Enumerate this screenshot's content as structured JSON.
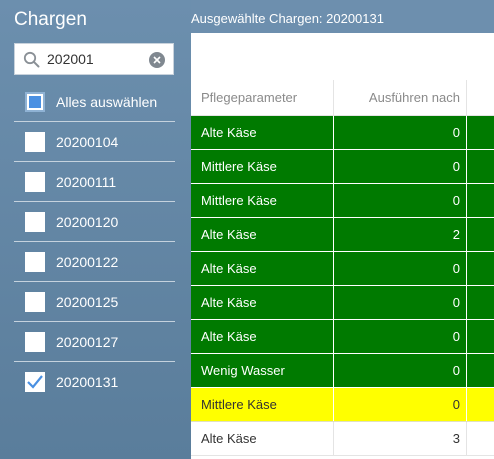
{
  "sidebar": {
    "title": "Chargen",
    "search": {
      "value": "202001",
      "placeholder": ""
    },
    "select_all_label": "Alles auswählen",
    "items": [
      {
        "label": "20200104",
        "checked": false
      },
      {
        "label": "20200111",
        "checked": false
      },
      {
        "label": "20200120",
        "checked": false
      },
      {
        "label": "20200122",
        "checked": false
      },
      {
        "label": "20200125",
        "checked": false
      },
      {
        "label": "20200127",
        "checked": false
      },
      {
        "label": "20200131",
        "checked": true
      }
    ]
  },
  "main": {
    "title": "Ausgewählte Chargen: 20200131",
    "columns": [
      "Pflegeparameter",
      "Ausführen nach",
      ""
    ],
    "rows": [
      {
        "parameter": "Alte Käse",
        "after": "0",
        "status": "green"
      },
      {
        "parameter": "Mittlere Käse",
        "after": "0",
        "status": "green"
      },
      {
        "parameter": "Mittlere Käse",
        "after": "0",
        "status": "green"
      },
      {
        "parameter": "Alte Käse",
        "after": "2",
        "status": "green"
      },
      {
        "parameter": "Alte Käse",
        "after": "0",
        "status": "green"
      },
      {
        "parameter": "Alte Käse",
        "after": "0",
        "status": "green"
      },
      {
        "parameter": "Alte Käse",
        "after": "0",
        "status": "green"
      },
      {
        "parameter": "Wenig Wasser",
        "after": "0",
        "status": "green"
      },
      {
        "parameter": "Mittlere Käse",
        "after": "0",
        "status": "yellow"
      },
      {
        "parameter": "Alte Käse",
        "after": "3",
        "status": "white"
      }
    ]
  },
  "colors": {
    "sidebar_bg": "#6d8fae",
    "row_green": "#007a00",
    "row_yellow": "#ffff00",
    "check_accent": "#4a90e2"
  },
  "icons": {
    "search": "search-icon",
    "clear": "clear-icon",
    "check": "checkmark-icon"
  }
}
